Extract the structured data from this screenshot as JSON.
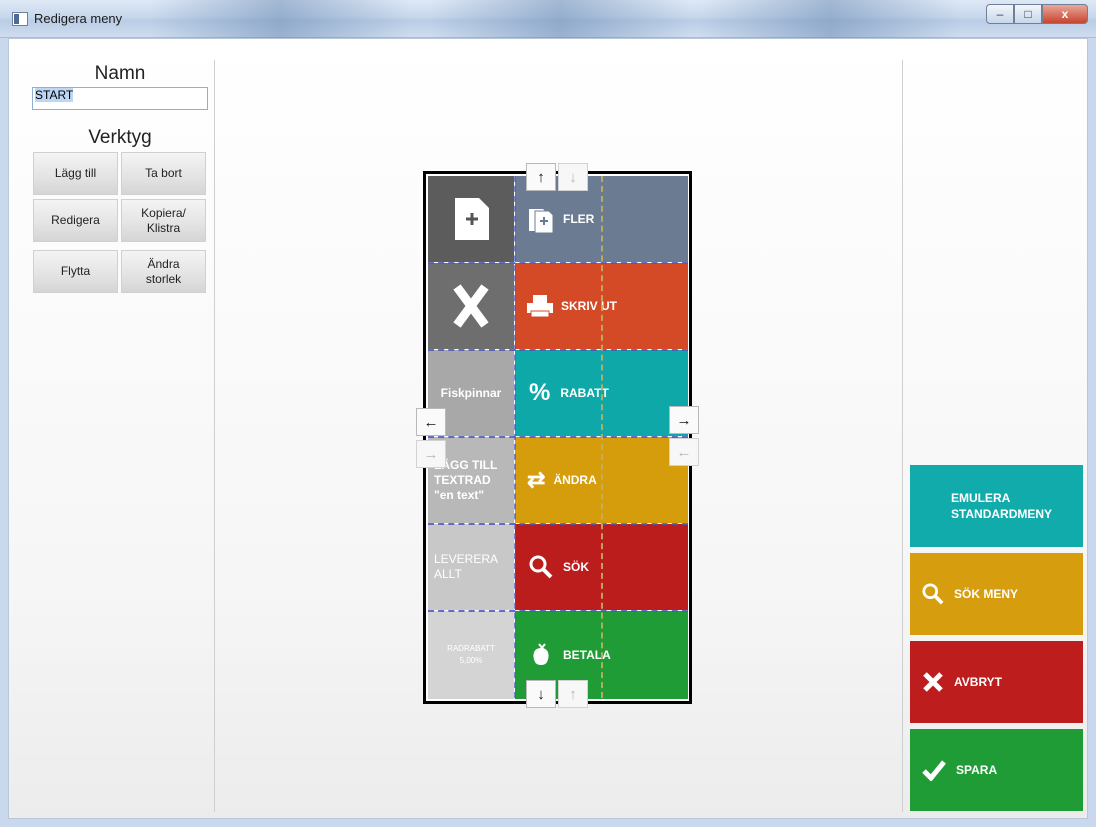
{
  "window": {
    "title": "Redigera meny",
    "buttons": {
      "minimize": "–",
      "maximize": "□",
      "close": "x"
    }
  },
  "left_panel": {
    "name_label": "Namn",
    "name_value": "START",
    "tools_label": "Verktyg",
    "tools": [
      {
        "id": "add",
        "label": "Lägg till"
      },
      {
        "id": "remove",
        "label": "Ta bort"
      },
      {
        "id": "edit",
        "label": "Redigera"
      },
      {
        "id": "copy",
        "label": "Kopiera/\nKlistra"
      },
      {
        "id": "move",
        "label": "Flytta"
      },
      {
        "id": "resize",
        "label": "Ändra\nstorlek"
      }
    ]
  },
  "grid": {
    "left_column": [
      {
        "label": "",
        "icon": "add-page-icon",
        "color": "#5c5c5c"
      },
      {
        "label": "",
        "icon": "big-x-icon",
        "color": "#6e6e6e"
      },
      {
        "label": "Fiskpinnar",
        "color": "#a8a8a8"
      },
      {
        "label": "LÄGG TILL\nTEXTRAD\n\"en text\"",
        "color": "#b8b8b8"
      },
      {
        "label": "LEVERERA\nALLT",
        "color": "#c8c8c8"
      },
      {
        "label": "RADRABATT\n5,00%",
        "color": "#d4d4d4"
      }
    ],
    "right_column": [
      {
        "label": "FLER",
        "icon": "more-pages-icon",
        "color": "#6b7b92"
      },
      {
        "label": "SKRIV UT",
        "icon": "printer-icon",
        "color": "#d44a27"
      },
      {
        "label": "RABATT",
        "icon": "percent-icon",
        "color": "#0fa8a8"
      },
      {
        "label": "ÄNDRA",
        "icon": "swap-arrows-icon",
        "color": "#d59d0c"
      },
      {
        "label": "SÖK",
        "icon": "magnifier-icon",
        "color": "#bb1d1d"
      },
      {
        "label": "BETALA",
        "icon": "money-icon",
        "color": "#1f9c35"
      }
    ],
    "arrows": {
      "up": "↑",
      "down": "↓",
      "left": "←",
      "right": "→"
    }
  },
  "actions": [
    {
      "id": "emulate",
      "label": "EMULERA\nSTANDARDMENY",
      "icon": "",
      "color": "#12abab"
    },
    {
      "id": "search",
      "label": "SÖK MENY",
      "icon": "magnifier-icon",
      "color": "#d69e0e"
    },
    {
      "id": "cancel",
      "label": "AVBRYT",
      "icon": "cross-icon",
      "color": "#bd1d1d"
    },
    {
      "id": "save",
      "label": "SPARA",
      "icon": "checkmark-icon",
      "color": "#1f9c35"
    }
  ]
}
